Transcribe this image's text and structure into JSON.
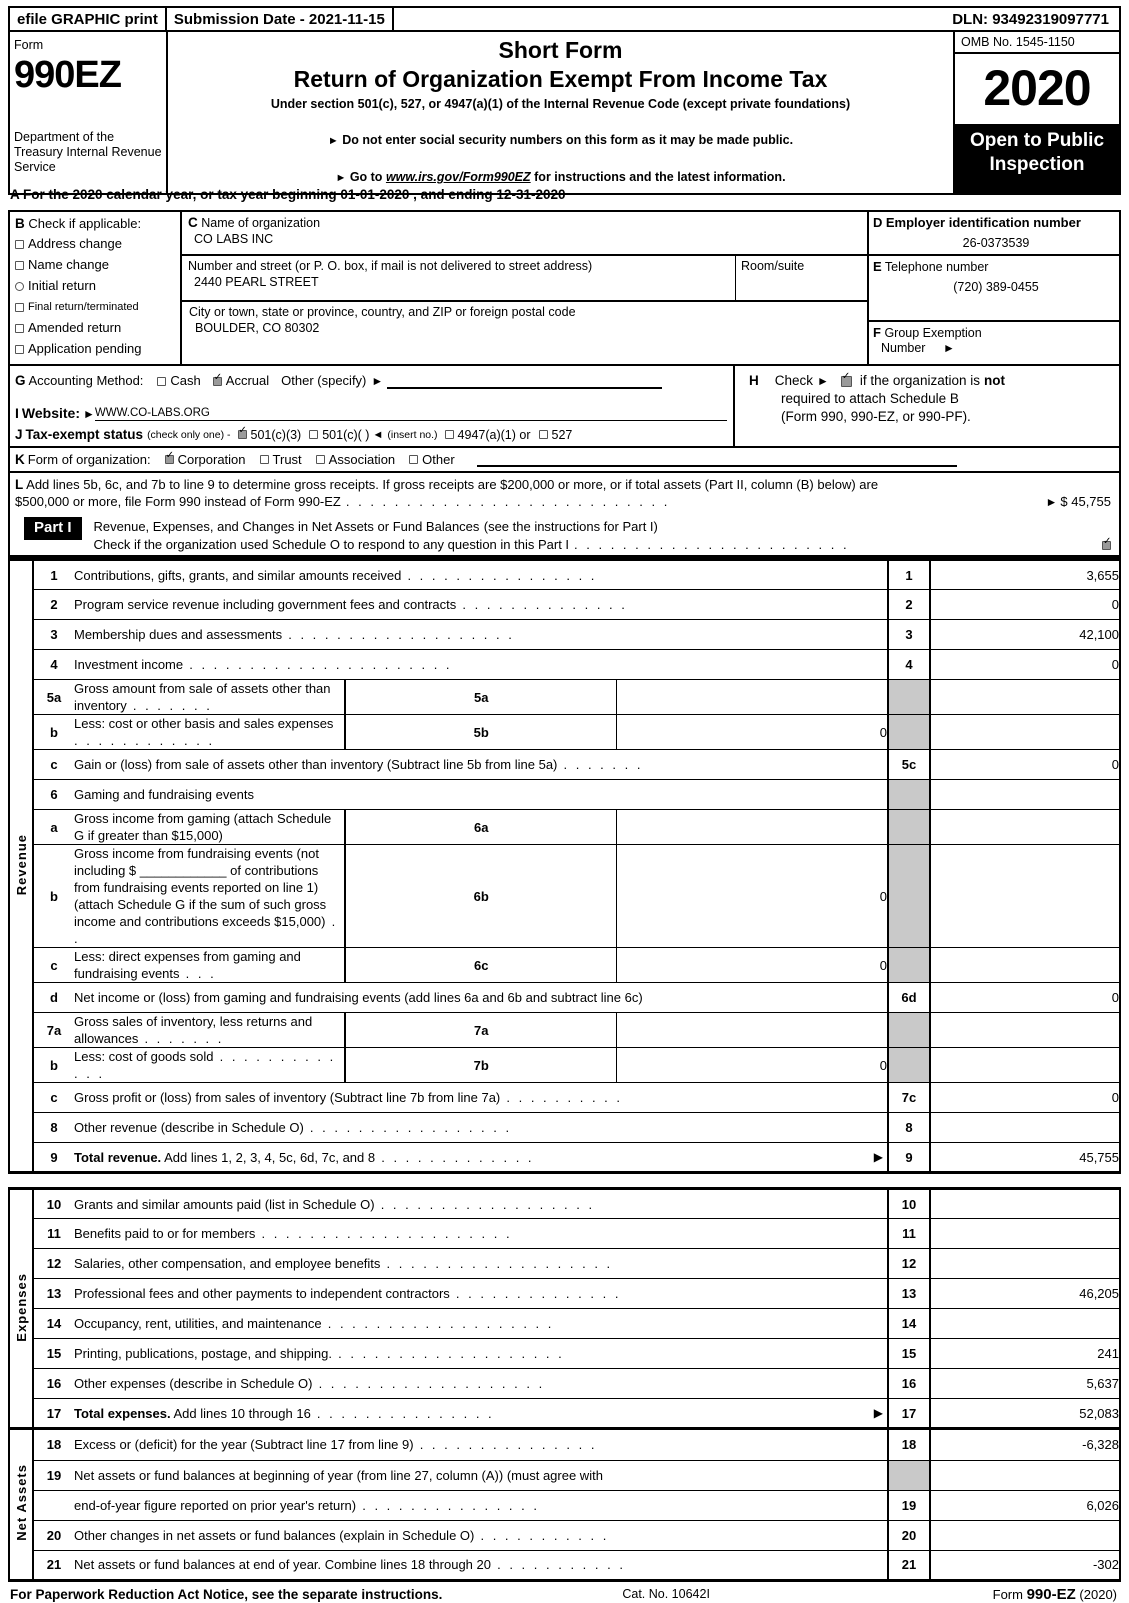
{
  "efile_bar": {
    "print_label": "efile GRAPHIC print",
    "submission_date": "Submission Date - 2021-11-15",
    "dln": "DLN: 93492319097771"
  },
  "masthead": {
    "form_word": "Form",
    "form_number": "990EZ",
    "department": "Department of the Treasury Internal Revenue Service",
    "title_short": "Short Form",
    "title_main": "Return of Organization Exempt From Income Tax",
    "subtitle": "Under section 501(c), 527, or 4947(a)(1) of the Internal Revenue Code (except private foundations)",
    "bullet1": "Do not enter social security numbers on this form as it may be made public.",
    "bullet2_prefix": "Go to",
    "bullet2_link": "www.irs.gov/Form990EZ",
    "bullet2_suffix": "for instructions and the latest information.",
    "omb": "OMB No. 1545-1150",
    "year": "2020",
    "open_to_public": "Open to Public Inspection"
  },
  "line_a": "A  For the 2020 calendar year, or tax year beginning 01-01-2020 , and ending 12-31-2020",
  "section_b": {
    "letter": "B",
    "heading": "Check if applicable:",
    "items": [
      {
        "label": "Address change",
        "checked": false,
        "shape": "square"
      },
      {
        "label": "Name change",
        "checked": false,
        "shape": "square"
      },
      {
        "label": "Initial return",
        "checked": false,
        "shape": "round"
      },
      {
        "label": "Final return/terminated",
        "checked": false,
        "shape": "square",
        "small": true
      },
      {
        "label": "Amended return",
        "checked": false,
        "shape": "square"
      },
      {
        "label": "Application pending",
        "checked": false,
        "shape": "square"
      }
    ]
  },
  "section_c": {
    "letter": "C",
    "name_label": "Name of organization",
    "name_value": "CO LABS INC",
    "street_label": "Number and street (or P. O. box, if mail is not delivered to street address)",
    "street_value": "2440 PEARL STREET",
    "room_label": "Room/suite",
    "room_value": "",
    "city_label": "City or town, state or province, country, and ZIP or foreign postal code",
    "city_value": "BOULDER, CO   80302"
  },
  "section_d": {
    "letter": "D",
    "ein_label": "Employer identification number",
    "ein_value": "26-0373539",
    "tel_letter": "E",
    "tel_label": "Telephone number",
    "tel_value": "(720) 389-0455",
    "grp_letter": "F",
    "grp_label": "Group Exemption",
    "grp_label2": "Number",
    "grp_value": ""
  },
  "section_g": {
    "letter": "G",
    "label": "Accounting Method:",
    "cash": "Cash",
    "cash_checked": false,
    "accrual": "Accrual",
    "accrual_checked": true,
    "other": "Other (specify)"
  },
  "section_i": {
    "letter": "I",
    "label": "Website:",
    "value": "WWW.CO-LABS.ORG"
  },
  "section_j": {
    "letter": "J",
    "label": "Tax-exempt status",
    "note": "(check only one) -",
    "opt1": "501(c)(3)",
    "opt1_checked": true,
    "opt2": "501(c)(    )",
    "opt2_checked": false,
    "insert": "(insert no.)",
    "opt3": "4947(a)(1) or",
    "opt3_checked": false,
    "opt4": "527",
    "opt4_checked": false
  },
  "section_h": {
    "letter": "H",
    "line1_pre": "Check",
    "checked": true,
    "line1_post": "if the organization is",
    "line1_bold": "not",
    "line2": "required to attach Schedule B",
    "line3": "(Form 990, 990-EZ, or 990-PF)."
  },
  "section_k": {
    "letter": "K",
    "label": "Form of organization:",
    "options": [
      {
        "label": "Corporation",
        "checked": true
      },
      {
        "label": "Trust",
        "checked": false
      },
      {
        "label": "Association",
        "checked": false
      },
      {
        "label": "Other",
        "checked": false
      }
    ]
  },
  "section_l": {
    "letter": "L",
    "text1": "Add lines 5b, 6c, and 7b to line 9 to determine gross receipts. If gross receipts are $200,000 or more, or if total assets (Part II, column (B) below) are",
    "text2": "$500,000 or more, file Form 990 instead of Form 990-EZ",
    "gross_receipts": "$ 45,755"
  },
  "part1": {
    "label": "Part I",
    "title": "Revenue, Expenses, and Changes in Net Assets or Fund Balances",
    "title_note": "(see the instructions for Part I)",
    "schedule_o": "Check if the organization used Schedule O to respond to any question in this Part I",
    "schedule_o_checked": true
  },
  "side_labels": {
    "revenue": "Revenue",
    "expenses": "Expenses",
    "net_assets": "Net Assets"
  },
  "revenue_rows": [
    {
      "no": "1",
      "desc": "Contributions, gifts, grants, and similar amounts received",
      "dots": 16,
      "main_no": "1",
      "main_amt": "3,655"
    },
    {
      "no": "2",
      "desc": "Program service revenue including government fees and contracts",
      "dots": 14,
      "main_no": "2",
      "main_amt": "0"
    },
    {
      "no": "3",
      "desc": "Membership dues and assessments",
      "dots": 19,
      "main_no": "3",
      "main_amt": "42,100"
    },
    {
      "no": "4",
      "desc": "Investment income",
      "dots": 22,
      "main_no": "4",
      "main_amt": "0"
    },
    {
      "no": "5a",
      "desc": "Gross amount from sale of assets other than inventory",
      "dots": 7,
      "sub_no": "5a",
      "sub_amt": "",
      "main_no": "",
      "main_amt": "",
      "main_gray": true
    },
    {
      "no": "b",
      "desc": "Less: cost or other basis and sales expenses",
      "dots": 12,
      "sub_no": "5b",
      "sub_amt": "0",
      "main_no": "",
      "main_amt": "",
      "main_gray": true
    },
    {
      "no": "c",
      "desc": "Gain or (loss) from sale of assets other than inventory (Subtract line 5b from line 5a)",
      "dots": 7,
      "main_no": "5c",
      "main_amt": "0"
    },
    {
      "no": "6",
      "desc": "Gaming and fundraising events",
      "dots": 0,
      "main_no": "",
      "main_amt": "",
      "main_gray": true
    },
    {
      "no": "a",
      "desc": "Gross income from gaming (attach Schedule G if greater than $15,000)",
      "dots": 0,
      "sub_no": "6a",
      "sub_amt": "",
      "main_no": "",
      "main_amt": "",
      "main_gray": true
    },
    {
      "no": "b",
      "desc": "Gross income from fundraising events (not including $ ____________ of contributions from fundraising events reported on line 1) (attach Schedule G if the sum of such gross income and contributions exceeds $15,000)",
      "dots": 2,
      "sub_no": "6b",
      "sub_amt": "0",
      "main_no": "",
      "main_amt": "",
      "main_gray": true
    },
    {
      "no": "c",
      "desc": "Less: direct expenses from gaming and fundraising events",
      "dots": 3,
      "sub_no": "6c",
      "sub_amt": "0",
      "main_no": "",
      "main_amt": "",
      "main_gray": true
    },
    {
      "no": "d",
      "desc": "Net income or (loss) from gaming and fundraising events (add lines 6a and 6b and subtract line 6c)",
      "dots": 0,
      "main_no": "6d",
      "main_amt": "0"
    },
    {
      "no": "7a",
      "desc": "Gross sales of inventory, less returns and allowances",
      "dots": 7,
      "sub_no": "7a",
      "sub_amt": "",
      "main_no": "",
      "main_amt": "",
      "main_gray": true
    },
    {
      "no": "b",
      "desc": "Less: cost of goods sold",
      "dots": 13,
      "sub_no": "7b",
      "sub_amt": "0",
      "main_no": "",
      "main_amt": "",
      "main_gray": true
    },
    {
      "no": "c",
      "desc": "Gross profit or (loss) from sales of inventory (Subtract line 7b from line 7a)",
      "dots": 10,
      "main_no": "7c",
      "main_amt": "0"
    },
    {
      "no": "8",
      "desc": "Other revenue (describe in Schedule O)",
      "dots": 17,
      "main_no": "8",
      "main_amt": ""
    },
    {
      "no": "9",
      "desc_bold": "Total revenue.",
      "desc": " Add lines 1, 2, 3, 4, 5c, 6d, 7c, and 8",
      "dots": 13,
      "arrow": true,
      "main_no": "9",
      "main_amt": "45,755"
    }
  ],
  "expense_rows": [
    {
      "no": "10",
      "desc": "Grants and similar amounts paid (list in Schedule O)",
      "dots": 18,
      "main_no": "10",
      "main_amt": ""
    },
    {
      "no": "11",
      "desc": "Benefits paid to or for members",
      "dots": 21,
      "main_no": "11",
      "main_amt": ""
    },
    {
      "no": "12",
      "desc": "Salaries, other compensation, and employee benefits",
      "dots": 19,
      "main_no": "12",
      "main_amt": ""
    },
    {
      "no": "13",
      "desc": "Professional fees and other payments to independent contractors",
      "dots": 14,
      "main_no": "13",
      "main_amt": "46,205"
    },
    {
      "no": "14",
      "desc": "Occupancy, rent, utilities, and maintenance",
      "dots": 19,
      "main_no": "14",
      "main_amt": ""
    },
    {
      "no": "15",
      "desc": "Printing, publications, postage, and shipping.",
      "dots": 19,
      "main_no": "15",
      "main_amt": "241"
    },
    {
      "no": "16",
      "desc": "Other expenses (describe in Schedule O)",
      "dots": 19,
      "main_no": "16",
      "main_amt": "5,637"
    },
    {
      "no": "17",
      "desc_bold": "Total expenses.",
      "desc": " Add lines 10 through 16",
      "dots": 15,
      "arrow": true,
      "main_no": "17",
      "main_amt": "52,083"
    }
  ],
  "netassets_rows": [
    {
      "no": "18",
      "desc": "Excess or (deficit) for the year (Subtract line 17 from line 9)",
      "dots": 15,
      "main_no": "18",
      "main_amt": "-6,328"
    },
    {
      "no": "19",
      "desc": "Net assets or fund balances at beginning of year (from line 27, column (A)) (must agree with",
      "dots": 0,
      "main_no": "",
      "main_amt": "",
      "main_gray": true
    },
    {
      "no": "",
      "desc": "end-of-year figure reported on prior year's return)",
      "dots": 15,
      "main_no": "19",
      "main_amt": "6,026"
    },
    {
      "no": "20",
      "desc": "Other changes in net assets or fund balances (explain in Schedule O)",
      "dots": 11,
      "main_no": "20",
      "main_amt": ""
    },
    {
      "no": "21",
      "desc": "Net assets or fund balances at end of year. Combine lines 18 through 20",
      "dots": 11,
      "main_no": "21",
      "main_amt": "-302"
    }
  ],
  "footer": {
    "notice": "For Paperwork Reduction Act Notice, see the separate instructions.",
    "cat": "Cat. No. 10642I",
    "form_label": "Form",
    "form_num": "990-EZ",
    "form_year": "(2020)"
  }
}
